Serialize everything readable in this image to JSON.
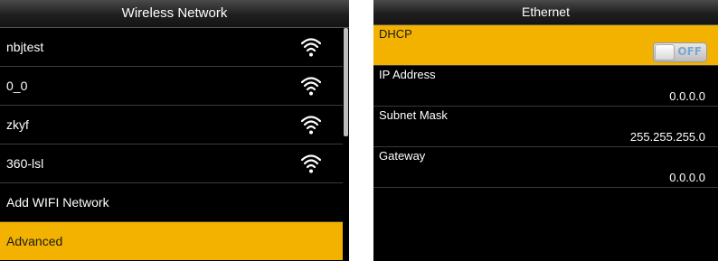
{
  "left_screen": {
    "title": "Wireless Network",
    "items": [
      {
        "label": "nbjtest",
        "icon": "wifi-icon"
      },
      {
        "label": "0_0",
        "icon": "wifi-icon"
      },
      {
        "label": "zkyf",
        "icon": "wifi-icon"
      },
      {
        "label": "360-lsl",
        "icon": "wifi-icon"
      },
      {
        "label": "Add WIFI Network"
      },
      {
        "label": "Advanced"
      }
    ]
  },
  "right_screen": {
    "title": "Ethernet",
    "dhcp": {
      "label": "DHCP",
      "toggle_state": "OFF"
    },
    "ip_address": {
      "label": "IP Address",
      "value": "0.0.0.0"
    },
    "subnet_mask": {
      "label": "Subnet Mask",
      "value": "255.255.255.0"
    },
    "gateway": {
      "label": "Gateway",
      "value": "0.0.0.0"
    }
  },
  "colors": {
    "highlight": "#f3b200",
    "background": "#000000",
    "text": "#ffffff",
    "toggle_text": "#7aa7cf"
  }
}
